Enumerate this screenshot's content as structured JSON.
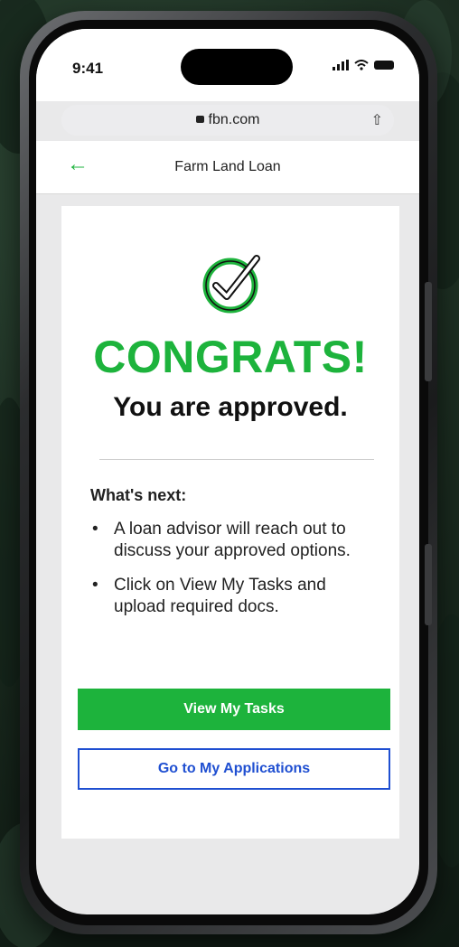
{
  "status_bar": {
    "time": "9:41"
  },
  "browser": {
    "url": "fbn.com"
  },
  "nav": {
    "title": "Farm Land Loan"
  },
  "card": {
    "headline": "CONGRATS!",
    "subheadline": "You are approved.",
    "next_heading": "What's next:",
    "next_steps": [
      "A loan advisor will reach out to discuss your approved options.",
      "Click on View My Tasks and upload required docs."
    ],
    "primary_button": "View My Tasks",
    "secondary_button": "Go to My Applications"
  },
  "colors": {
    "brand_green": "#1db33c",
    "link_blue": "#1f4fd1"
  },
  "icons": [
    "lock-icon",
    "share-icon",
    "back-arrow-icon",
    "check-circle-icon",
    "signal-icon",
    "wifi-icon",
    "battery-icon"
  ]
}
